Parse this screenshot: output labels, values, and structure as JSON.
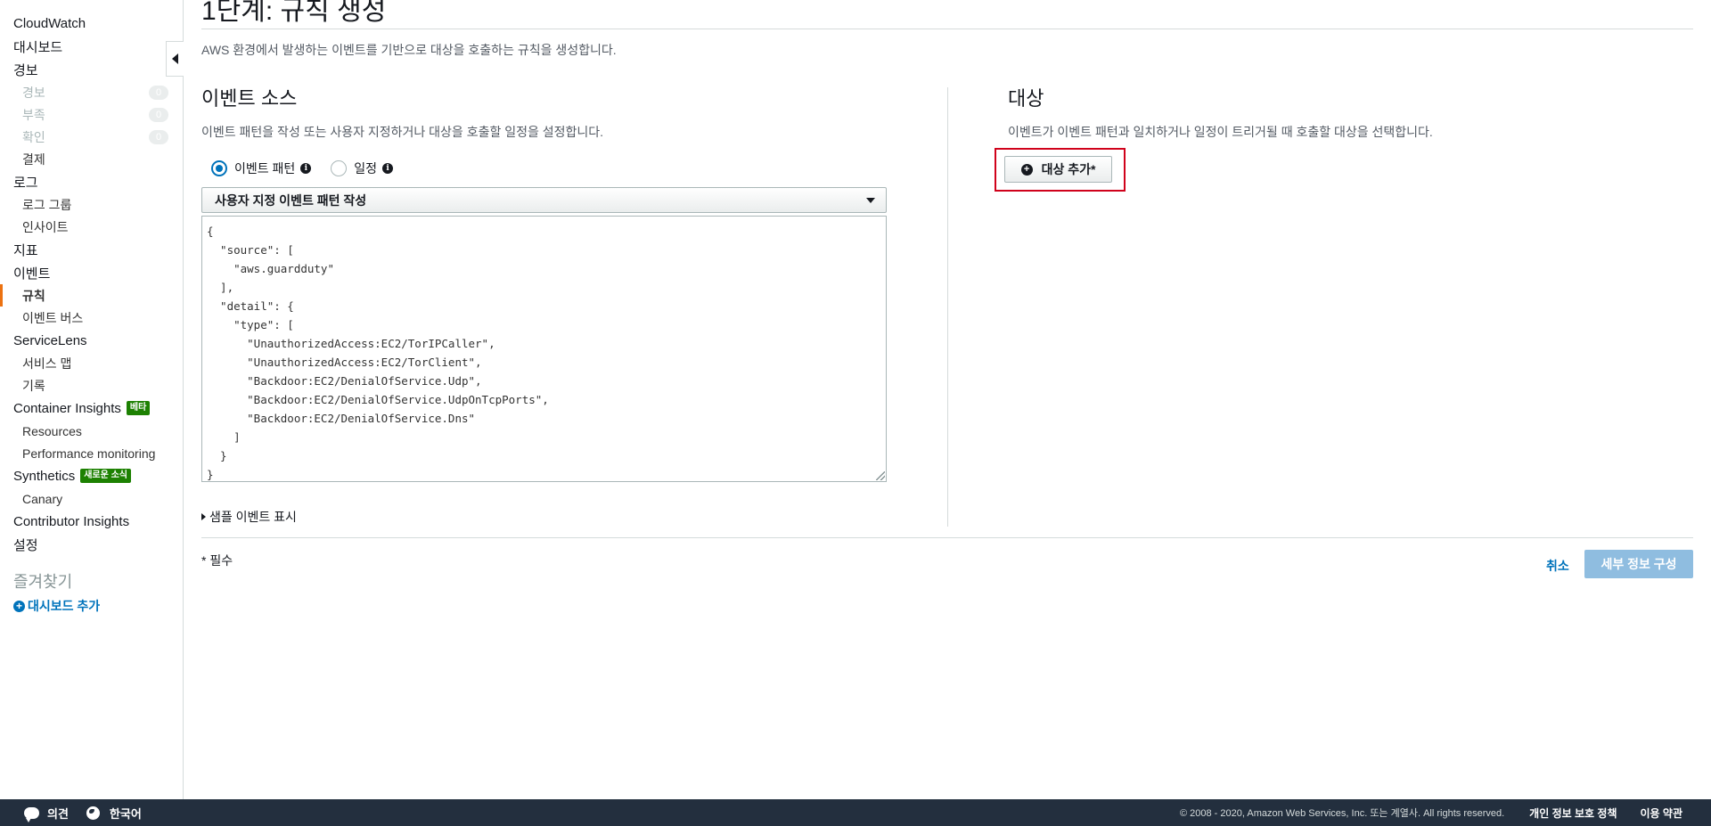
{
  "sidebar": {
    "items": [
      {
        "label": "CloudWatch",
        "level": 1
      },
      {
        "label": "대시보드",
        "level": 1
      },
      {
        "label": "경보",
        "level": 1
      },
      {
        "label": "경보",
        "level": 2,
        "disabled": true,
        "count": "0"
      },
      {
        "label": "부족",
        "level": 2,
        "disabled": true,
        "count": "0"
      },
      {
        "label": "확인",
        "level": 2,
        "disabled": true,
        "count": "0"
      },
      {
        "label": "결제",
        "level": 2
      },
      {
        "label": "로그",
        "level": 1
      },
      {
        "label": "로그 그룹",
        "level": 2
      },
      {
        "label": "인사이트",
        "level": 2
      },
      {
        "label": "지표",
        "level": 1
      },
      {
        "label": "이벤트",
        "level": 1
      },
      {
        "label": "규칙",
        "level": 2,
        "active": true
      },
      {
        "label": "이벤트 버스",
        "level": 2
      },
      {
        "label": "ServiceLens",
        "level": 1
      },
      {
        "label": "서비스 맵",
        "level": 2
      },
      {
        "label": "기록",
        "level": 2
      },
      {
        "label": "Container Insights",
        "level": 1,
        "badge": "베타"
      },
      {
        "label": "Resources",
        "level": 2
      },
      {
        "label": "Performance monitoring",
        "level": 2
      },
      {
        "label": "Synthetics",
        "level": 1,
        "badge": "새로운 소식"
      },
      {
        "label": "Canary",
        "level": 2
      },
      {
        "label": "Contributor Insights",
        "level": 1
      },
      {
        "label": "설정",
        "level": 1
      }
    ],
    "favorites_title": "즐겨찾기",
    "add_dashboard": "대시보드 추가"
  },
  "page": {
    "title": "1단계: 규칙 생성",
    "description": "AWS 환경에서 발생하는 이벤트를 기반으로 대상을 호출하는 규칙을 생성합니다."
  },
  "event_source": {
    "title": "이벤트 소스",
    "description": "이벤트 패턴을 작성 또는 사용자 지정하거나 대상을 호출할 일정을 설정합니다.",
    "radio_pattern": "이벤트 패턴",
    "radio_schedule": "일정",
    "selected": "pattern",
    "select_value": "사용자 지정 이벤트 패턴 작성",
    "code_lines": [
      "{",
      "  \"source\": [",
      "    \"aws.guardduty\"",
      "  ],",
      "  \"detail\": {",
      "    \"type\": [",
      "      \"UnauthorizedAccess:EC2/TorIPCaller\",",
      "      \"UnauthorizedAccess:EC2/TorClient\",",
      "      \"Backdoor:EC2/DenialOfService.Udp\",",
      "      \"Backdoor:EC2/DenialOfService.UdpOnTcpPorts\",",
      "      \"Backdoor:EC2/DenialOfService.Dns\"",
      "    ]",
      "  }",
      "}"
    ],
    "sample_toggle": "샘플 이벤트 표시"
  },
  "targets": {
    "title": "대상",
    "description": "이벤트가 이벤트 패턴과 일치하거나 일정이 트리거될 때 호출할 대상을 선택합니다.",
    "add_button": "대상 추가*"
  },
  "form": {
    "required_note": "* 필수",
    "cancel": "취소",
    "next": "세부 정보 구성"
  },
  "footer": {
    "feedback": "의견",
    "language": "한국어",
    "copyright": "© 2008 - 2020, Amazon Web Services, Inc. 또는 계열사. All rights reserved.",
    "privacy": "개인 정보 보호 정책",
    "terms": "이용 약관"
  },
  "colors": {
    "accent": "#0073bb",
    "active_marker": "#ec7211",
    "highlight_box": "#d0021b",
    "badge": "#1d8102",
    "footer_bg": "#232f3e"
  }
}
